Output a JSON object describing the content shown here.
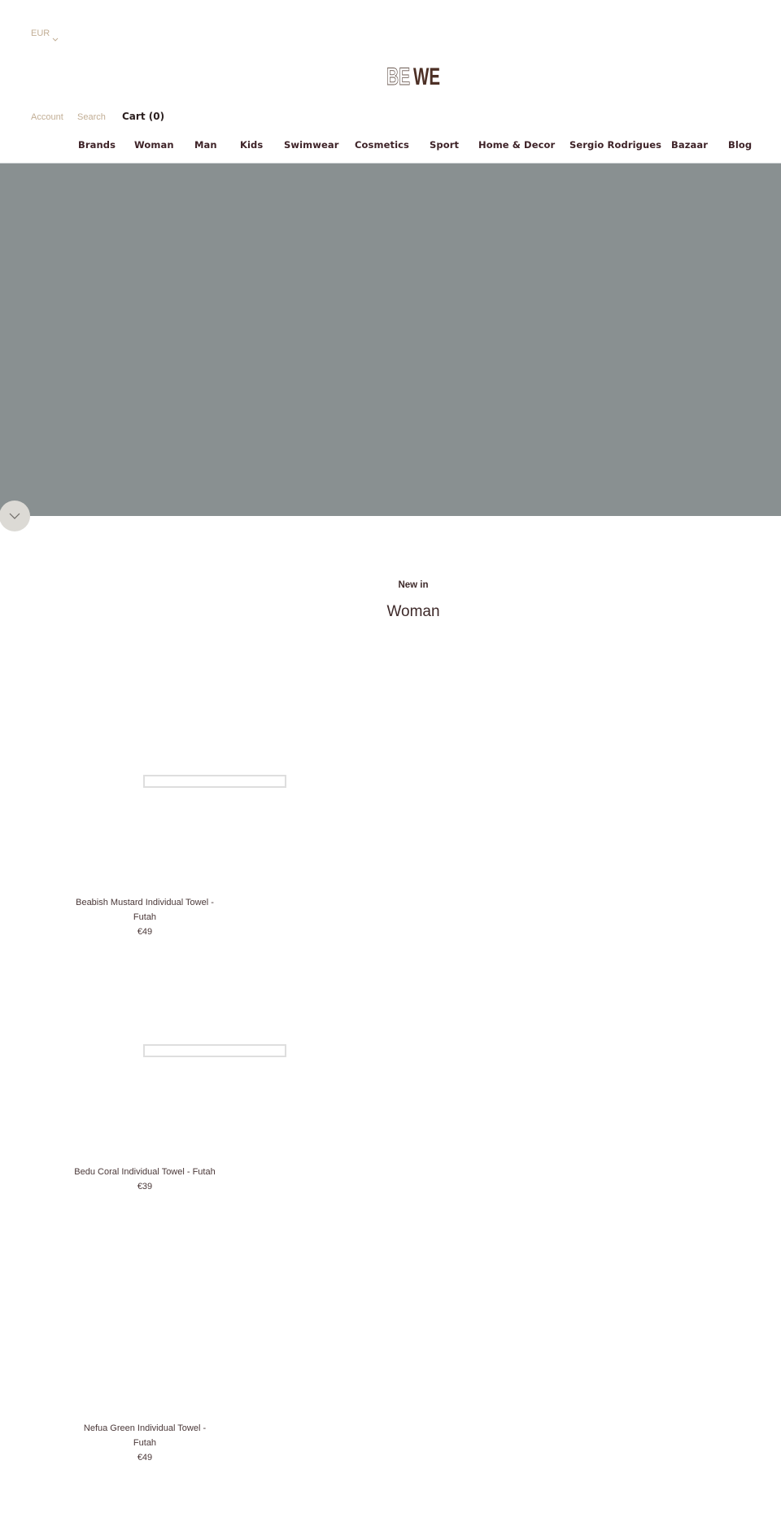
{
  "header": {
    "currency": "EUR",
    "logo": {
      "left": "BE",
      "right": "WE"
    },
    "links": {
      "account": "Account",
      "search": "Search",
      "cart": "Cart (0)"
    }
  },
  "nav": {
    "items": [
      {
        "label": "Brands"
      },
      {
        "label": "Woman"
      },
      {
        "label": "Man"
      },
      {
        "label": "Kids"
      },
      {
        "label": "Swimwear"
      },
      {
        "label": "Cosmetics"
      },
      {
        "label": "Sport"
      },
      {
        "label": "Home & Decor"
      },
      {
        "label": "Sergio Rodrigues"
      },
      {
        "label": "Bazaar"
      },
      {
        "label": "Blog"
      }
    ]
  },
  "colors": {
    "brand_dark": "#4d3026",
    "accent_tan": "#c2ae95",
    "hero_bg": "#899091"
  },
  "section": {
    "eyebrow": "New in",
    "title": "Woman"
  },
  "products": [
    {
      "name": "Beabish Mustard Individual Towel - Futah",
      "price": "€49"
    },
    {
      "name": "Bedu Coral Individual Towel - Futah",
      "price": "€39"
    },
    {
      "name": "Nefua Green Individual Towel - Futah",
      "price": "€49"
    }
  ]
}
